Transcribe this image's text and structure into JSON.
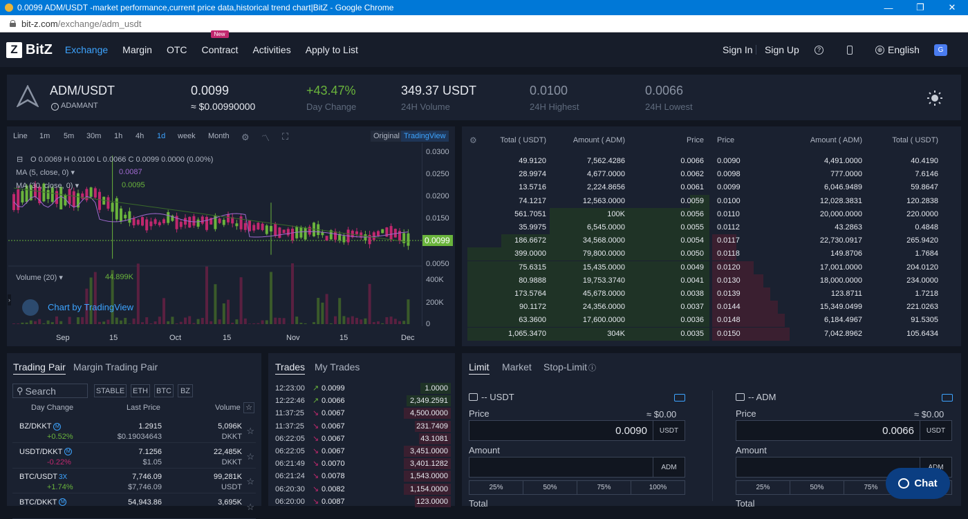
{
  "window": {
    "title": "0.0099 ADM/USDT -market performance,current price data,historical trend chart|BitZ - Google Chrome",
    "url_domain": "bit-z.com",
    "url_path": "/exchange/adm_usdt"
  },
  "nav": {
    "logo_mark": "Z",
    "logo_text": "BitZ",
    "items": [
      {
        "label": "Exchange",
        "active": true
      },
      {
        "label": "Margin"
      },
      {
        "label": "OTC"
      },
      {
        "label": "Contract",
        "badge": "New"
      },
      {
        "label": "Activities"
      },
      {
        "label": "Apply to List"
      }
    ],
    "sign_in": "Sign In",
    "sign_up": "Sign Up",
    "help_icon": "?",
    "language": "English"
  },
  "ticker": {
    "pair": "ADM/USDT",
    "coin_name": "ADAMANT",
    "price": "0.0099",
    "price_fiat": "≈ $0.00990000",
    "change": "+43.47%",
    "change_label": "Day Change",
    "volume": "349.37 USDT",
    "volume_label": "24H Volume",
    "high": "0.0100",
    "high_label": "24H Highest",
    "low": "0.0066",
    "low_label": "24H Lowest"
  },
  "chart": {
    "intervals": [
      "Line",
      "1m",
      "5m",
      "30m",
      "1h",
      "4h",
      "1d",
      "week",
      "Month"
    ],
    "active_interval": "1d",
    "view_original": "Original",
    "view_tradingview": "TradingView",
    "ohlc": "O 0.0069  H 0.0100  L 0.0066  C 0.0099  0.0000 (0.00%)",
    "ma5": "MA (5, close, 0)",
    "ma5_val": "0.0087",
    "ma30": "MA (30, close, 0)",
    "ma30_val": "0.0095",
    "volume_label": "Volume (20)",
    "volume_val": "44.899K",
    "attribution": "Chart by TradingView",
    "price_axis": [
      "0.0300",
      "0.0250",
      "0.0200",
      "0.0150",
      "0.0050"
    ],
    "current_price": "0.0099",
    "volume_axis": [
      "400K",
      "200K",
      "0"
    ],
    "x_labels": [
      "Sep",
      "15",
      "Oct",
      "15",
      "Nov",
      "15",
      "Dec"
    ]
  },
  "orderbook": {
    "headers": {
      "total_usdt": "Total ( USDT)",
      "amount_adm": "Amount ( ADM)",
      "price": "Price"
    },
    "bids": [
      [
        "49.9120",
        "7,562.4286",
        "0.0066"
      ],
      [
        "28.9974",
        "4,677.0000",
        "0.0062"
      ],
      [
        "13.5716",
        "2,224.8656",
        "0.0061"
      ],
      [
        "74.1217",
        "12,563.0000",
        "0.0059"
      ],
      [
        "561.7051",
        "100K",
        "0.0056"
      ],
      [
        "35.9975",
        "6,545.0000",
        "0.0055"
      ],
      [
        "186.6672",
        "34,568.0000",
        "0.0054"
      ],
      [
        "399.0000",
        "79,800.0000",
        "0.0050"
      ],
      [
        "75.6315",
        "15,435.0000",
        "0.0049"
      ],
      [
        "80.9888",
        "19,753.3740",
        "0.0041"
      ],
      [
        "173.5764",
        "45,678.0000",
        "0.0038"
      ],
      [
        "90.1172",
        "24,356.0000",
        "0.0037"
      ],
      [
        "63.3600",
        "17,600.0000",
        "0.0036"
      ],
      [
        "1,065.3470",
        "304K",
        "0.0035"
      ]
    ],
    "asks": [
      [
        "0.0090",
        "4,491.0000",
        "40.4190"
      ],
      [
        "0.0098",
        "777.0000",
        "7.6146"
      ],
      [
        "0.0099",
        "6,046.9489",
        "59.8647"
      ],
      [
        "0.0100",
        "12,028.3831",
        "120.2838"
      ],
      [
        "0.0110",
        "20,000.0000",
        "220.0000"
      ],
      [
        "0.0112",
        "43.2863",
        "0.4848"
      ],
      [
        "0.0117",
        "22,730.0917",
        "265.9420"
      ],
      [
        "0.0118",
        "149.8706",
        "1.7684"
      ],
      [
        "0.0120",
        "17,001.0000",
        "204.0120"
      ],
      [
        "0.0130",
        "18,000.0000",
        "234.0000"
      ],
      [
        "0.0139",
        "123.8711",
        "1.7218"
      ],
      [
        "0.0144",
        "15,349.0499",
        "221.0263"
      ],
      [
        "0.0148",
        "6,184.4967",
        "91.5305"
      ],
      [
        "0.0150",
        "7,042.8962",
        "105.6434"
      ]
    ]
  },
  "pairs_panel": {
    "tab1": "Trading Pair",
    "tab2": "Margin Trading Pair",
    "search": "Search",
    "filters": [
      "STABLE",
      "ETH",
      "BTC",
      "BZ"
    ],
    "col_change": "Day Change",
    "col_price": "Last Price",
    "col_volume": "Volume",
    "rows": [
      {
        "pair": "BZ/DKKT",
        "tag": "M",
        "change": "+0.52%",
        "up": true,
        "price": "1.2915",
        "fiat": "$0.19034643",
        "vol": "5,096K",
        "vol_unit": "DKKT"
      },
      {
        "pair": "USDT/DKKT",
        "tag": "M",
        "change": "-0.22%",
        "up": false,
        "price": "7.1256",
        "fiat": "$1.05",
        "vol": "22,485K",
        "vol_unit": "DKKT"
      },
      {
        "pair": "BTC/USDT",
        "tag": "3X",
        "change": "+1.74%",
        "up": true,
        "price": "7,746.09",
        "fiat": "$7,746.09",
        "vol": "99,281K",
        "vol_unit": "USDT"
      },
      {
        "pair": "BTC/DKKT",
        "tag": "M",
        "change": "",
        "up": true,
        "price": "54,943.86",
        "fiat": "",
        "vol": "3,695K",
        "vol_unit": ""
      }
    ]
  },
  "trades_panel": {
    "tab1": "Trades",
    "tab2": "My Trades",
    "rows": [
      [
        "12:23:00",
        "up",
        "0.0099",
        "1.0000"
      ],
      [
        "12:22:46",
        "up",
        "0.0066",
        "2,349.2591"
      ],
      [
        "11:37:25",
        "down",
        "0.0067",
        "4,500.0000"
      ],
      [
        "11:37:25",
        "down",
        "0.0067",
        "231.7409"
      ],
      [
        "06:22:05",
        "down",
        "0.0067",
        "43.1081"
      ],
      [
        "06:22:05",
        "down",
        "0.0067",
        "3,451.0000"
      ],
      [
        "06:21:49",
        "down",
        "0.0070",
        "3,401.1282"
      ],
      [
        "06:21:24",
        "down",
        "0.0078",
        "1,543.0000"
      ],
      [
        "06:20:30",
        "down",
        "0.0082",
        "1,154.0000"
      ],
      [
        "06:20:00",
        "down",
        "0.0087",
        "123.0000"
      ]
    ]
  },
  "order_form": {
    "tabs": [
      "Limit",
      "Market",
      "Stop-Limit"
    ],
    "buy": {
      "balance": "-- USDT",
      "price_label": "Price",
      "price_fiat": "≈ $0.00",
      "price": "0.0090",
      "unit": "USDT",
      "amount_label": "Amount",
      "amount_unit": "ADM",
      "total_label": "Total"
    },
    "sell": {
      "balance": "-- ADM",
      "price_label": "Price",
      "price_fiat": "≈ $0.00",
      "price": "0.0066",
      "unit": "USDT",
      "amount_label": "Amount",
      "amount_unit": "ADM",
      "total_label": "Total"
    },
    "percents": [
      "25%",
      "50%",
      "75%",
      "100%"
    ],
    "chat": "Chat"
  },
  "colors": {
    "up": "#6ab43c",
    "down": "#c0286e",
    "accent": "#3da4ff"
  }
}
